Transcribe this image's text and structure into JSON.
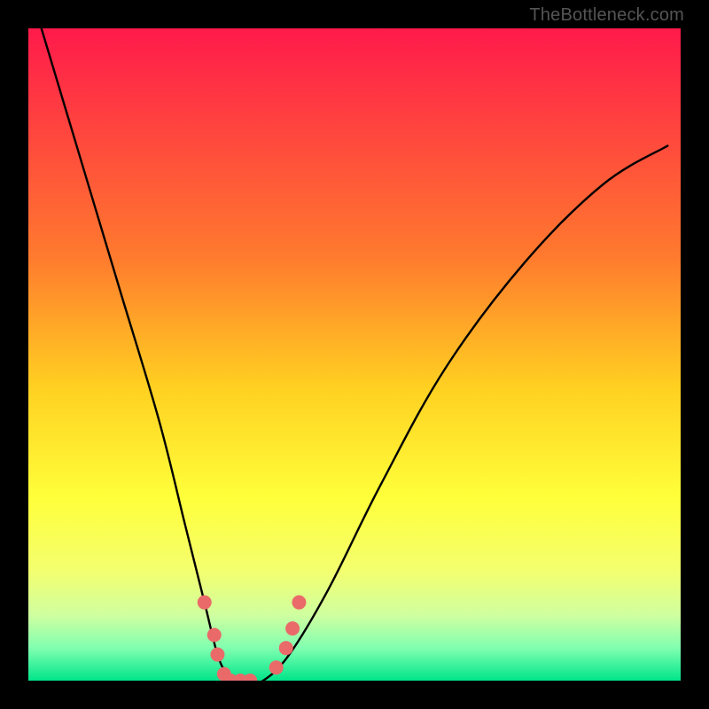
{
  "watermark": "TheBottleneck.com",
  "chart_data": {
    "type": "line",
    "title": "",
    "xlabel": "",
    "ylabel": "",
    "xlim": [
      0,
      100
    ],
    "ylim": [
      0,
      100
    ],
    "grid": false,
    "legend": false,
    "background": {
      "type": "vertical-gradient",
      "stops": [
        {
          "offset": 0,
          "color": "#ff1a4b"
        },
        {
          "offset": 35,
          "color": "#ff7a2e"
        },
        {
          "offset": 55,
          "color": "#ffd021"
        },
        {
          "offset": 72,
          "color": "#ffff3a"
        },
        {
          "offset": 83,
          "color": "#f4ff6e"
        },
        {
          "offset": 90,
          "color": "#cfffa0"
        },
        {
          "offset": 95,
          "color": "#80ffb0"
        },
        {
          "offset": 100,
          "color": "#00e58b"
        }
      ]
    },
    "series": [
      {
        "name": "bottleneck-curve",
        "color": "#000000",
        "x": [
          2,
          8,
          14,
          20,
          24,
          27,
          29,
          30.5,
          32,
          34,
          36,
          40,
          46,
          54,
          64,
          76,
          88,
          98
        ],
        "y": [
          100,
          80,
          60,
          40,
          24,
          12,
          4,
          1,
          0,
          0,
          0,
          4,
          14,
          30,
          48,
          64,
          76,
          82
        ]
      }
    ],
    "markers": {
      "name": "highlight-points",
      "color": "#ea6a6a",
      "size": 8,
      "points": [
        {
          "x": 27.0,
          "y": 12.0
        },
        {
          "x": 28.5,
          "y": 7.0
        },
        {
          "x": 29.0,
          "y": 4.0
        },
        {
          "x": 30.0,
          "y": 1.0
        },
        {
          "x": 31.0,
          "y": 0.0
        },
        {
          "x": 32.5,
          "y": 0.0
        },
        {
          "x": 34.0,
          "y": 0.0
        },
        {
          "x": 38.0,
          "y": 2.0
        },
        {
          "x": 39.5,
          "y": 5.0
        },
        {
          "x": 40.5,
          "y": 8.0
        },
        {
          "x": 41.5,
          "y": 12.0
        }
      ]
    }
  }
}
